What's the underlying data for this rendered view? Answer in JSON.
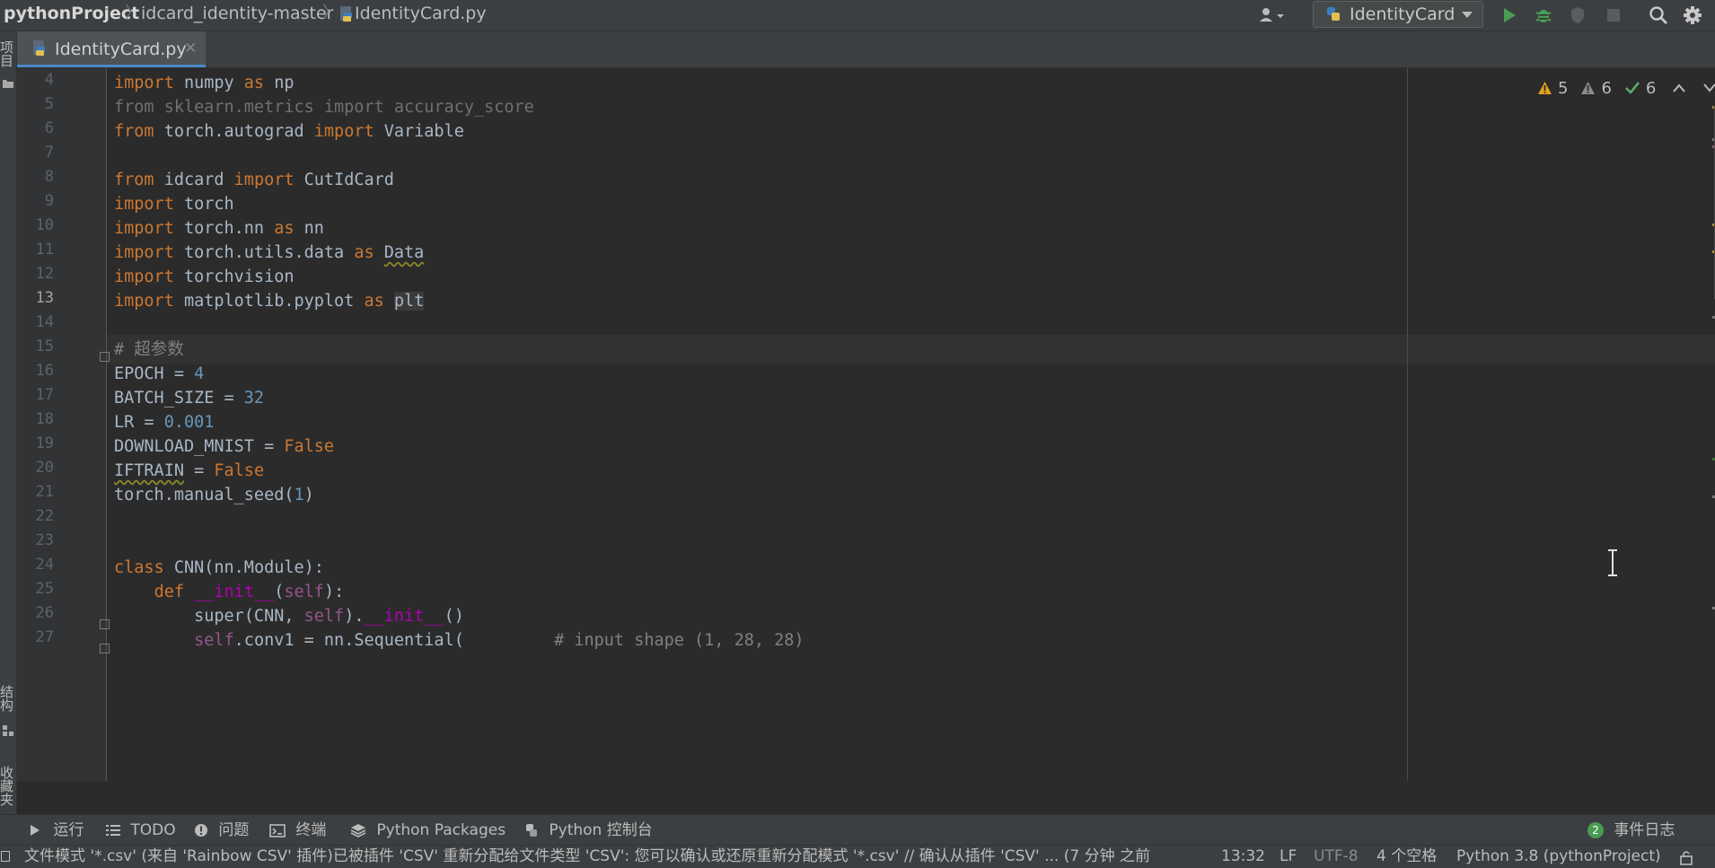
{
  "breadcrumbs": {
    "project": "pythonProject",
    "folder": "idcard_identity-master",
    "file": "IdentityCard.py"
  },
  "run_config": {
    "name": "IdentityCard"
  },
  "tabs": [
    {
      "label": "IdentityCard.py"
    }
  ],
  "left_strip": {
    "project_label": "项目",
    "structure_label": "结构",
    "favorites_label": "收藏夹"
  },
  "inspection": {
    "warnings": "5",
    "weak_warnings": "6",
    "typos": "6"
  },
  "editor": {
    "current_line": "13",
    "lines": [
      {
        "n": "4"
      },
      {
        "n": "5"
      },
      {
        "n": "6"
      },
      {
        "n": "7"
      },
      {
        "n": "8"
      },
      {
        "n": "9"
      },
      {
        "n": "10"
      },
      {
        "n": "11"
      },
      {
        "n": "12"
      },
      {
        "n": "13"
      },
      {
        "n": "14"
      },
      {
        "n": "15"
      },
      {
        "n": "16"
      },
      {
        "n": "17"
      },
      {
        "n": "18"
      },
      {
        "n": "19"
      },
      {
        "n": "20"
      },
      {
        "n": "21"
      },
      {
        "n": "22"
      },
      {
        "n": "23"
      },
      {
        "n": "24"
      },
      {
        "n": "25"
      },
      {
        "n": "26"
      },
      {
        "n": "27"
      }
    ],
    "tokens": {
      "import": "import",
      "from": "from",
      "as": "as",
      "class": "class",
      "def": "def",
      "numpy": " numpy ",
      "np": " np",
      "l5": "from sklearn.metrics import accuracy_score",
      "torch_autograd": " torch.autograd ",
      "Variable": " Variable",
      "idcard": " idcard ",
      "CutIdCard": " CutIdCard",
      "torch": " torch",
      "torch_nn": " torch.nn ",
      "nn": " nn",
      "torch_utils_data": " torch.utils.data ",
      "Data": "Data",
      "torchvision": " torchvision",
      "matplotlib": " matplotlib.pyplot ",
      "plt": "plt",
      "l15": "# 超参数",
      "epoch_lhs": "EPOCH = ",
      "epoch_val": "4",
      "batch_lhs": "BATCH_SIZE = ",
      "batch_val": "32",
      "lr_lhs": "LR = ",
      "lr_val": "0.001",
      "dl_lhs": "DOWNLOAD_MNIST = ",
      "false": "False",
      "iftrain": "IFTRAIN",
      "eq": " = ",
      "seed_a": "torch.manual_seed(",
      "seed_val": "1",
      "seed_b": ")",
      "cnn_decl": " CNN(nn.Module):",
      "init_name": "__init__",
      "lp": "(",
      "self": "self",
      "rp_colon": "):",
      "super_a": "super(CNN, ",
      "super_b": ").",
      "super_c": "()",
      "conv1": ".conv1 = nn.Sequential(",
      "conv_cmt": "         # input shape (1, 28, 28)"
    }
  },
  "tool_windows": {
    "run": "运行",
    "todo": "TODO",
    "problems": "问题",
    "terminal": "终端",
    "packages": "Python Packages",
    "console": "Python 控制台",
    "event_log": "事件日志",
    "event_count": "2"
  },
  "status": {
    "message": "文件模式 '*.csv' (来自 'Rainbow CSV' 插件)已被插件 'CSV' 重新分配给文件类型 'CSV': 您可以确认或还原重新分配模式 '*.csv' // 确认从插件 'CSV' ... (7 分钟 之前",
    "position": "13:32",
    "line_sep": "LF",
    "encoding": "UTF-8",
    "indent": "4 个空格",
    "interpreter": "Python 3.8 (pythonProject)"
  },
  "colors": {
    "keyword": "#cc7832",
    "number": "#6897bb",
    "comment": "#808080",
    "accent": "#4a88c7",
    "run_green": "#499c54"
  }
}
